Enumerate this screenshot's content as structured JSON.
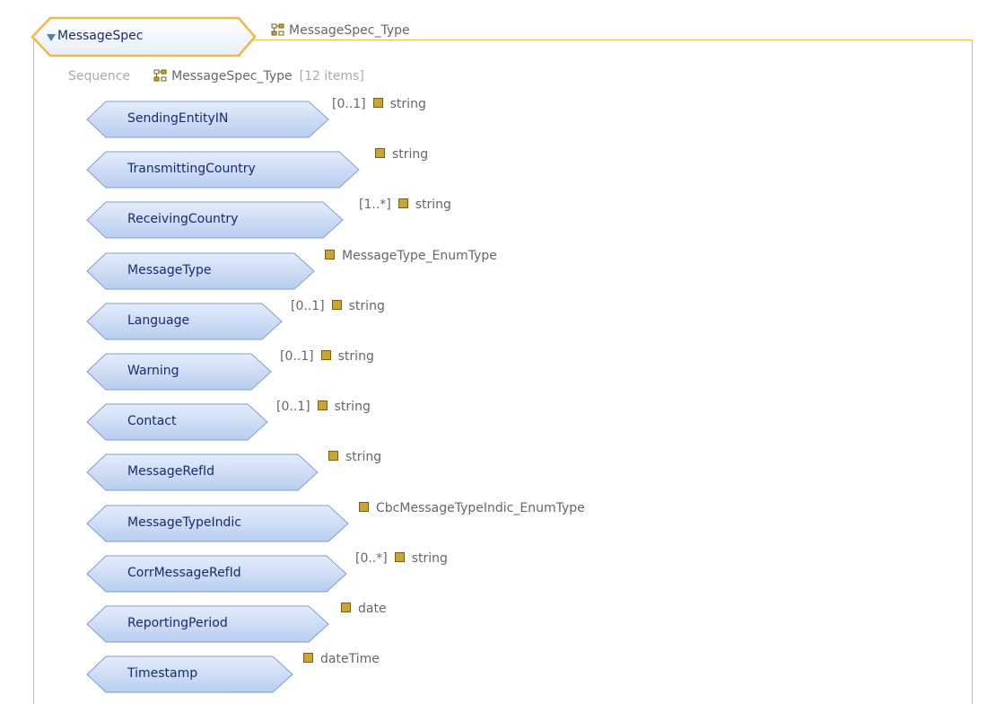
{
  "root": {
    "name": "MessageSpec",
    "type": "MessageSpec_Type",
    "expand_icon": "triangle-down-icon",
    "type_icon": "complex-type-icon"
  },
  "sequence": {
    "label": "Sequence",
    "type": "MessageSpec_Type",
    "count": "[12 items]"
  },
  "elements": [
    {
      "name": "SendingEntityIN",
      "cardinality": "[0..1]",
      "type": "string"
    },
    {
      "name": "TransmittingCountry",
      "cardinality": "",
      "type": "string"
    },
    {
      "name": "ReceivingCountry",
      "cardinality": "[1..*]",
      "type": "string"
    },
    {
      "name": "MessageType",
      "cardinality": "",
      "type": "MessageType_EnumType"
    },
    {
      "name": "Language",
      "cardinality": "[0..1]",
      "type": "string"
    },
    {
      "name": "Warning",
      "cardinality": "[0..1]",
      "type": "string"
    },
    {
      "name": "Contact",
      "cardinality": "[0..1]",
      "type": "string"
    },
    {
      "name": "MessageRefId",
      "cardinality": "",
      "type": "string"
    },
    {
      "name": "MessageTypeIndic",
      "cardinality": "",
      "type": "CbcMessageTypeIndic_EnumType"
    },
    {
      "name": "CorrMessageRefId",
      "cardinality": "[0..*]",
      "type": "string"
    },
    {
      "name": "ReportingPeriod",
      "cardinality": "",
      "type": "date"
    },
    {
      "name": "Timestamp",
      "cardinality": "",
      "type": "dateTime"
    }
  ],
  "colors": {
    "root_border": "#f0b84a",
    "element_fill": "#c9d8f4",
    "element_border": "#7f9dd0",
    "type_square": "#c9a437"
  }
}
